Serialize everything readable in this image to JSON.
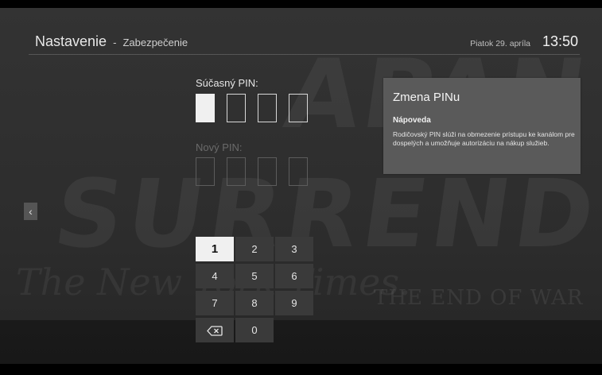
{
  "header": {
    "title": "Nastavenie",
    "separator": "-",
    "subtitle": "Zabezpečenie",
    "date": "Piatok 29. apríla",
    "time": "13:50"
  },
  "pin": {
    "current_label": "Súčasný PIN:",
    "new_label": "Nový PIN:"
  },
  "help": {
    "title": "Zmena PINu",
    "subtitle": "Nápoveda",
    "text": "Rodičovský PIN slúži na obmezenie prístupu ke kanálom pre dospelých a umožňuje autorizáciu na nákup služieb."
  },
  "nav": {
    "left_icon": "chevron-left-icon",
    "left_glyph": "‹"
  },
  "keypad": {
    "keys": [
      "1",
      "2",
      "3",
      "4",
      "5",
      "6",
      "7",
      "8",
      "9"
    ],
    "zero": "0",
    "backspace_icon": "backspace-icon"
  },
  "background": {
    "headline_top": "APAN",
    "headline_main": "SURRENDERS",
    "masthead": "The New York Times.",
    "subhead": "THE END OF WAR"
  },
  "colors": {
    "panel": "#5a5a5a",
    "key": "#3a3a3a",
    "key_selected": "#f0f0f0"
  }
}
